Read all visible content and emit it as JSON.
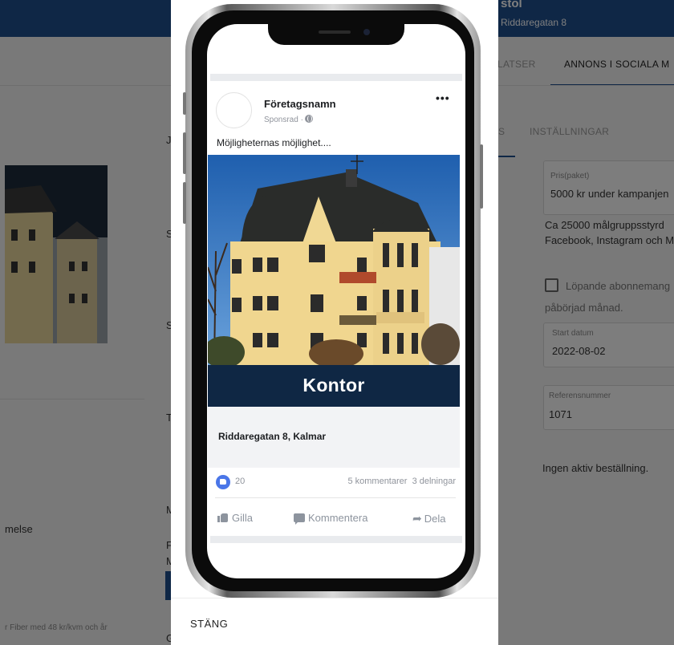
{
  "background": {
    "header_title": "stol",
    "header_subtitle": "Riddaregatan 8",
    "tabs": {
      "platser": "LATSER",
      "social": "ANNONS I SOCIALA M"
    },
    "subtabs": {
      "partial": "S",
      "settings": "INSTÄLLNINGAR"
    },
    "price_label": "Pris(paket)",
    "price_value": "5000 kr under kampanjen",
    "reach_line1": "Ca 25000 målgruppsstyrd",
    "reach_line2": "Facebook, Instagram och M",
    "subscription_label": "Löpande abonnemang",
    "subscription_note": "påbörjad månad.",
    "start_date_label": "Start datum",
    "start_date_value": "2022-08-02",
    "reference_label": "Referensnummer",
    "reference_value": "1071",
    "order_status": "Ingen aktiv beställning.",
    "left_text_melse": "melse",
    "left_footer_text": "r Fiber med 48 kr/kvm och år",
    "mid_letters": [
      "J",
      "S",
      "S",
      "T",
      "M",
      "F",
      "M",
      "G"
    ]
  },
  "modal": {
    "close_label": "STÄNG",
    "post": {
      "page_name": "Företagsnamn",
      "sponsored_label": "Sponsrad ·",
      "more_label": "•••",
      "text": "Möjligheternas möjlighet....",
      "banner_text": "Kontor",
      "link_title": "Riddaregatan 8, Kalmar",
      "like_count": "20",
      "comments": "5 kommentarer",
      "shares": "3 delningar",
      "actions": {
        "like": "Gilla",
        "comment": "Kommentera",
        "share": "Dela"
      }
    }
  },
  "colors": {
    "brand_navy": "#0f2744",
    "header_blue": "#1f4e8c",
    "like_blue": "#4a76e8"
  }
}
